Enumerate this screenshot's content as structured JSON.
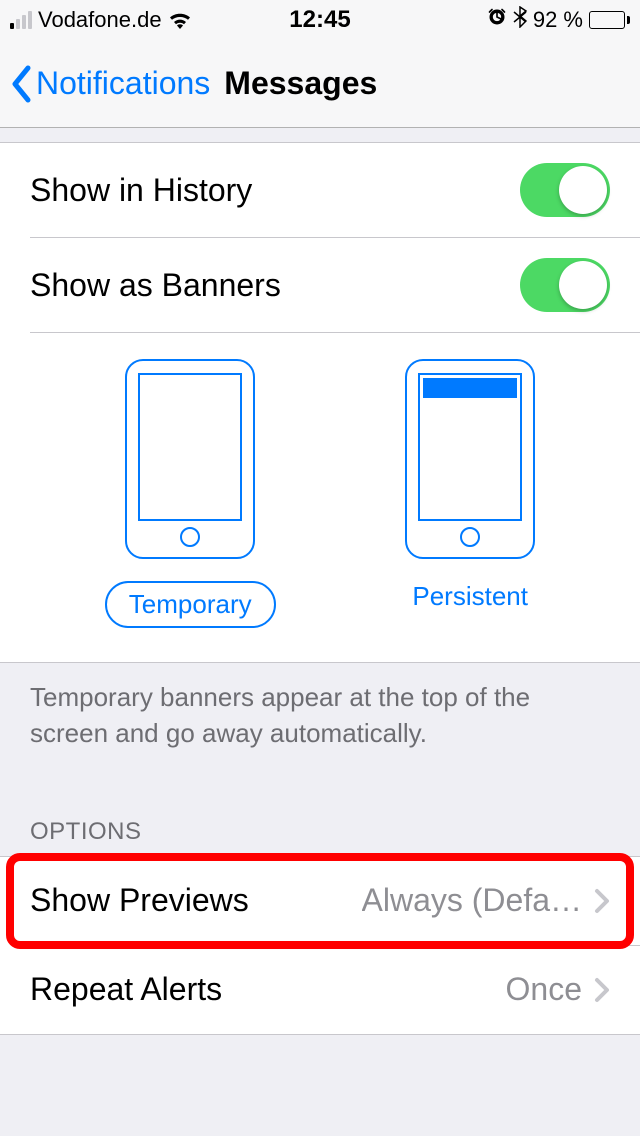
{
  "status": {
    "carrier": "Vodafone.de",
    "time": "12:45",
    "battery_pct": "92 %"
  },
  "nav": {
    "back_label": "Notifications",
    "title": "Messages"
  },
  "toggles": {
    "show_history": "Show in History",
    "show_banners": "Show as Banners"
  },
  "banner_styles": {
    "temporary": "Temporary",
    "persistent": "Persistent"
  },
  "footer_text": "Temporary banners appear at the top of the screen and go away automatically.",
  "options_header": "OPTIONS",
  "rows": {
    "show_previews": {
      "label": "Show Previews",
      "value": "Always (Defa…"
    },
    "repeat_alerts": {
      "label": "Repeat Alerts",
      "value": "Once"
    }
  }
}
